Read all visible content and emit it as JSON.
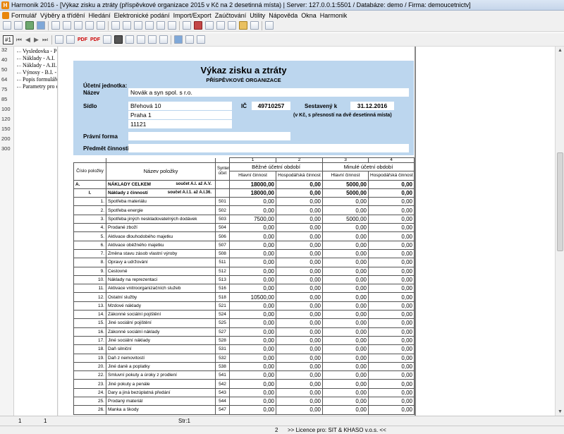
{
  "window": {
    "title": "Harmonik 2016 - [Výkaz zisku a ztráty (příspěvkové organizace 2015 v Kč na 2 desetinná místa) | Server: 127.0.0.1:5501 / Databáze: demo / Firma: demoucetnictv]"
  },
  "menu": [
    "Formulář",
    "Výběry a třídění",
    "Hledání",
    "Elektronické podání",
    "Import/Export",
    "Zaúčtování",
    "Utility",
    "Nápověda",
    "Okna",
    "Harmonik"
  ],
  "toolbar": {
    "page_label": "#1",
    "pdf_label": "PDF"
  },
  "left_panel": {
    "ruler": [
      "32",
      "40",
      "50",
      "64",
      "75",
      "85",
      "100",
      "120",
      "150",
      "200",
      "300"
    ],
    "tree": [
      "Vysledovka - P",
      "Náklady - A.I.",
      "Náklady - A.II.",
      "Výnosy - B.I. - I",
      "Popis formuláře",
      "Parametry pro e"
    ]
  },
  "header": {
    "title": "Výkaz zisku a ztráty",
    "subtitle": "PŘÍSPĚVKOVÉ ORGANIZACE",
    "accounting_unit_label": "Účetní jednotka:",
    "name_label": "Název",
    "name_value": "Novák a syn spol. s r.o.",
    "seat_label": "Sídlo",
    "street": "Břehová 10",
    "city": "Praha 1",
    "zip": "11121",
    "ic_label": "IČ",
    "ic_value": "49710257",
    "compiled_label": "Sestavený k",
    "compiled_value": "31.12.2016",
    "currency_note": "(v Kč, s přesností na dvě desetinná místa)",
    "legal_form_label": "Právní forma",
    "activity_label": "Předmět činnosti"
  },
  "table": {
    "col_numbers": [
      "1",
      "2",
      "3",
      "4"
    ],
    "header_item_no": "Číslo položky",
    "header_item_name": "Název položky",
    "header_synt": "Synter účet",
    "header_current": "Běžné účetní období",
    "header_previous": "Minulé účetní období",
    "header_main": "Hlavní činnost",
    "header_economic": "Hospodářská činnost",
    "rows": [
      {
        "no": "A.",
        "name": "NÁKLADY CELKEM",
        "note": "součet A.I. až A.V.",
        "acct": "",
        "c1": "18000,00",
        "c2": "0,00",
        "c3": "5000,00",
        "c4": "0,00",
        "bold": true
      },
      {
        "no": "I.",
        "name": "Náklady z činností",
        "note": "součet A.I.1. až A.I.36.",
        "acct": "",
        "c1": "18000,00",
        "c2": "0,00",
        "c3": "5000,00",
        "c4": "0,00",
        "bold": true
      },
      {
        "no": "1.",
        "name": "Spotřeba materiálu",
        "acct": "501",
        "c1": "0,00",
        "c2": "0,00",
        "c3": "0,00",
        "c4": "0,00"
      },
      {
        "no": "2.",
        "name": "Spotřeba energie",
        "acct": "502",
        "c1": "0,00",
        "c2": "0,00",
        "c3": "0,00",
        "c4": "0,00"
      },
      {
        "no": "3.",
        "name": "Spotřeba jiných neskladovatelných dodávek",
        "acct": "503",
        "c1": "7500,00",
        "c2": "0,00",
        "c3": "5000,00",
        "c4": "0,00"
      },
      {
        "no": "4.",
        "name": "Prodané zboží",
        "acct": "504",
        "c1": "0,00",
        "c2": "0,00",
        "c3": "0,00",
        "c4": "0,00"
      },
      {
        "no": "5.",
        "name": "Aktivace dlouhodobého majetku",
        "acct": "506",
        "c1": "0,00",
        "c2": "0,00",
        "c3": "0,00",
        "c4": "0,00"
      },
      {
        "no": "6.",
        "name": "Aktivace oběžného majetku",
        "acct": "507",
        "c1": "0,00",
        "c2": "0,00",
        "c3": "0,00",
        "c4": "0,00"
      },
      {
        "no": "7.",
        "name": "Změna stavu zásob vlastní výroby",
        "acct": "508",
        "c1": "0,00",
        "c2": "0,00",
        "c3": "0,00",
        "c4": "0,00"
      },
      {
        "no": "8.",
        "name": "Opravy a udržování",
        "acct": "511",
        "c1": "0,00",
        "c2": "0,00",
        "c3": "0,00",
        "c4": "0,00"
      },
      {
        "no": "9.",
        "name": "Cestovné",
        "acct": "512",
        "c1": "0,00",
        "c2": "0,00",
        "c3": "0,00",
        "c4": "0,00"
      },
      {
        "no": "10.",
        "name": "Náklady na reprezentaci",
        "acct": "513",
        "c1": "0,00",
        "c2": "0,00",
        "c3": "0,00",
        "c4": "0,00"
      },
      {
        "no": "11.",
        "name": "Aktivace vnitroorganizačních služeb",
        "acct": "516",
        "c1": "0,00",
        "c2": "0,00",
        "c3": "0,00",
        "c4": "0,00"
      },
      {
        "no": "12.",
        "name": "Ostatní služby",
        "acct": "518",
        "c1": "10500,00",
        "c2": "0,00",
        "c3": "0,00",
        "c4": "0,00"
      },
      {
        "no": "13.",
        "name": "Mzdové náklady",
        "acct": "521",
        "c1": "0,00",
        "c2": "0,00",
        "c3": "0,00",
        "c4": "0,00"
      },
      {
        "no": "14.",
        "name": "Zákonné sociální pojištění",
        "acct": "524",
        "c1": "0,00",
        "c2": "0,00",
        "c3": "0,00",
        "c4": "0,00"
      },
      {
        "no": "15.",
        "name": "Jiné sociální pojištění",
        "acct": "525",
        "c1": "0,00",
        "c2": "0,00",
        "c3": "0,00",
        "c4": "0,00"
      },
      {
        "no": "16.",
        "name": "Zákonné sociální náklady",
        "acct": "527",
        "c1": "0,00",
        "c2": "0,00",
        "c3": "0,00",
        "c4": "0,00"
      },
      {
        "no": "17.",
        "name": "Jiné sociální náklady",
        "acct": "528",
        "c1": "0,00",
        "c2": "0,00",
        "c3": "0,00",
        "c4": "0,00"
      },
      {
        "no": "18.",
        "name": "Daň silniční",
        "acct": "531",
        "c1": "0,00",
        "c2": "0,00",
        "c3": "0,00",
        "c4": "0,00"
      },
      {
        "no": "19.",
        "name": "Daň z nemovitostí",
        "acct": "532",
        "c1": "0,00",
        "c2": "0,00",
        "c3": "0,00",
        "c4": "0,00"
      },
      {
        "no": "20.",
        "name": "Jiné daně a poplatky",
        "acct": "538",
        "c1": "0,00",
        "c2": "0,00",
        "c3": "0,00",
        "c4": "0,00"
      },
      {
        "no": "22.",
        "name": "Smluvní pokuty a úroky z prodlení",
        "acct": "541",
        "c1": "0,00",
        "c2": "0,00",
        "c3": "0,00",
        "c4": "0,00"
      },
      {
        "no": "23.",
        "name": "Jiné pokuty a penále",
        "acct": "542",
        "c1": "0,00",
        "c2": "0,00",
        "c3": "0,00",
        "c4": "0,00"
      },
      {
        "no": "24.",
        "name": "Dary a jiná bezúplatná předání",
        "acct": "543",
        "c1": "0,00",
        "c2": "0,00",
        "c3": "0,00",
        "c4": "0,00"
      },
      {
        "no": "25.",
        "name": "Prodaný materiál",
        "acct": "544",
        "c1": "0,00",
        "c2": "0,00",
        "c3": "0,00",
        "c4": "0,00"
      },
      {
        "no": "26.",
        "name": "Manka a škody",
        "acct": "547",
        "c1": "0,00",
        "c2": "0,00",
        "c3": "0,00",
        "c4": "0,00"
      }
    ]
  },
  "status": {
    "field1": "1",
    "field2": "1",
    "sheet": "Str:1",
    "count": "2",
    "license": ">> Licence pro:  SIT & KHASO v.o.s. <<"
  }
}
